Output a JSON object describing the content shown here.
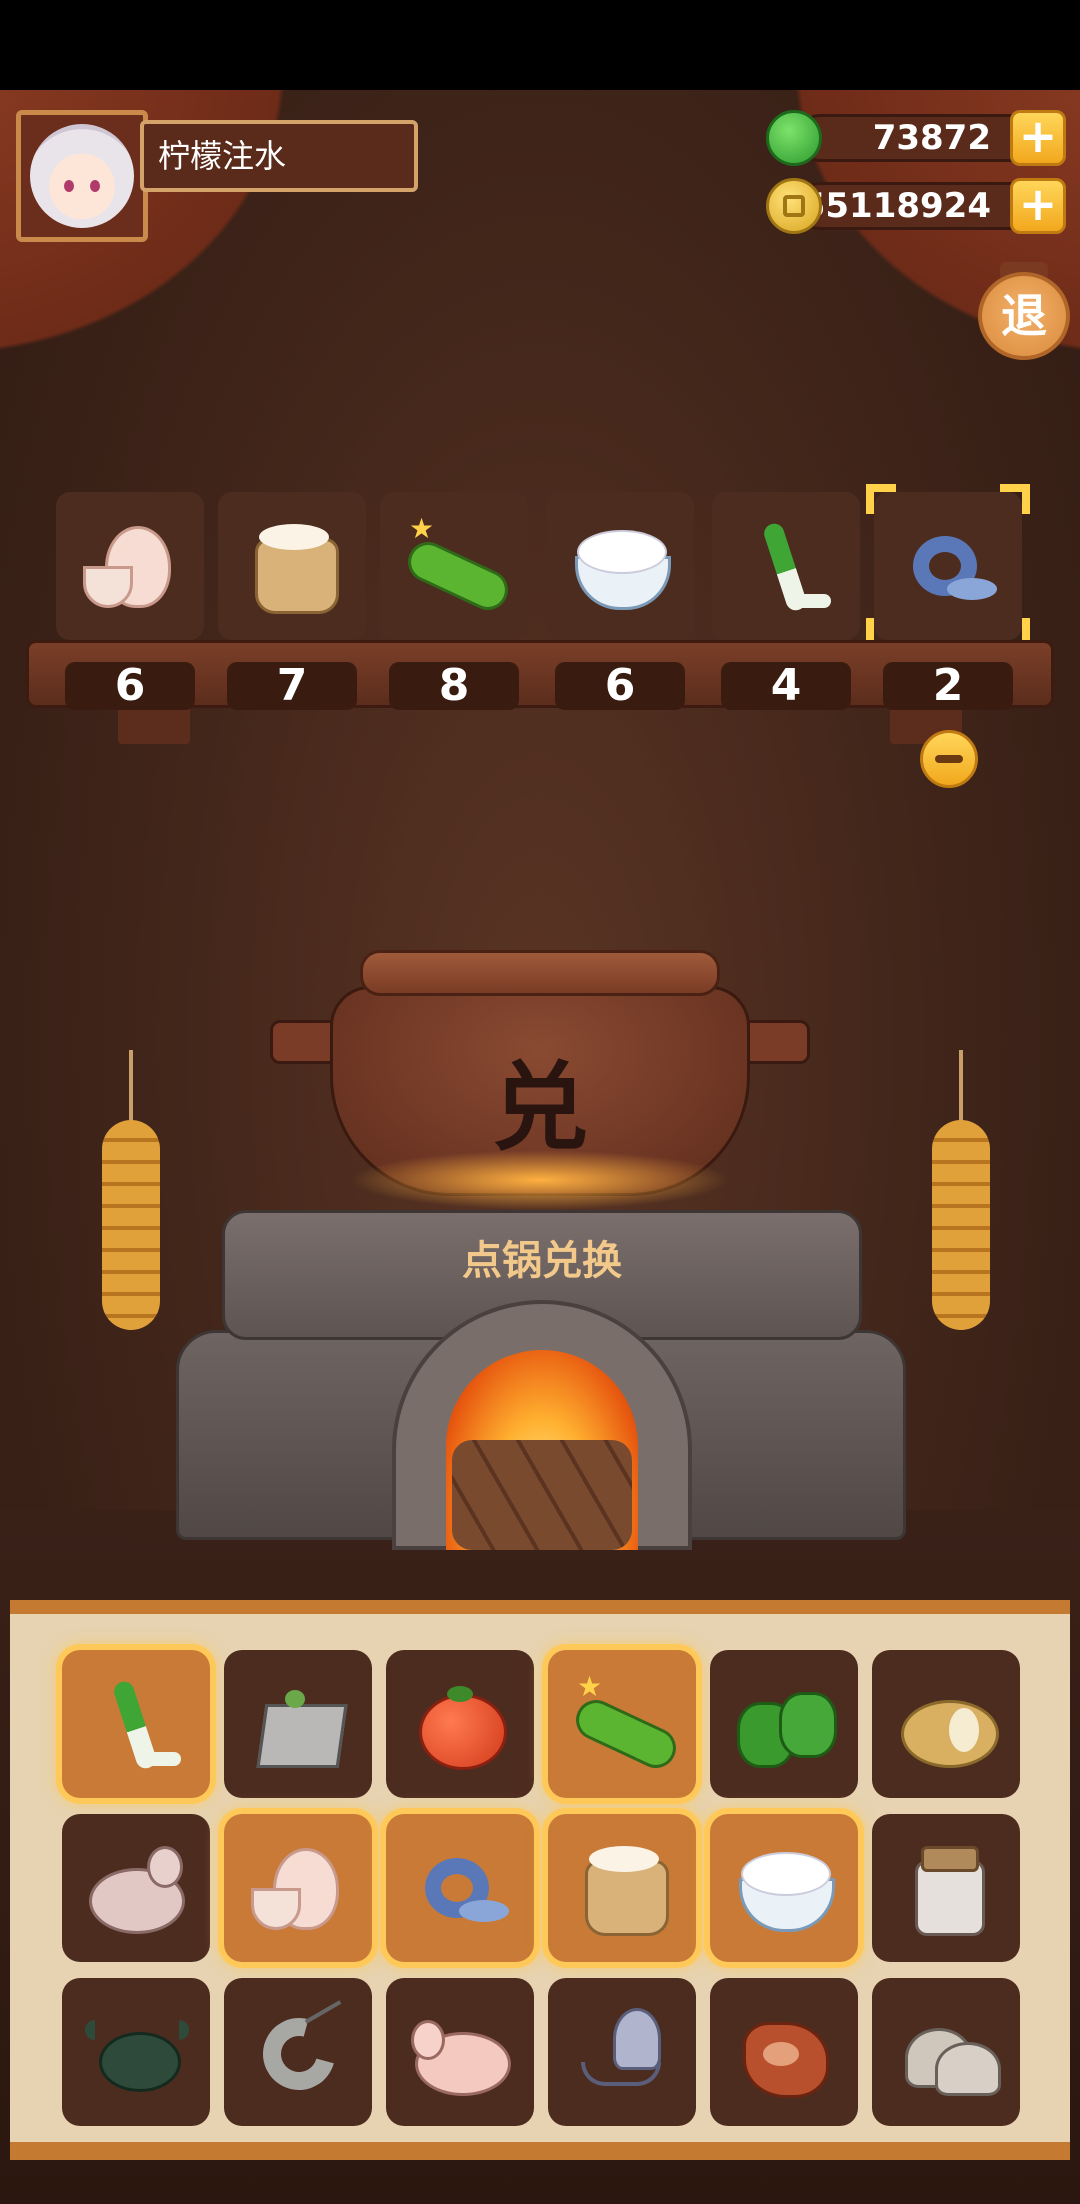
{
  "player": {
    "name": "柠檬注水",
    "avatar": "chef-girl-avatar"
  },
  "currencies": [
    {
      "icon": "jade-coin-icon",
      "value": "73872"
    },
    {
      "icon": "gold-coin-icon",
      "value": "55118924"
    }
  ],
  "exit_label": "退",
  "slots": [
    {
      "icon": "egg",
      "count": "6"
    },
    {
      "icon": "flour",
      "count": "7"
    },
    {
      "icon": "cucumber",
      "count": "8"
    },
    {
      "icon": "rice",
      "count": "6"
    },
    {
      "icon": "leek",
      "count": "4"
    },
    {
      "icon": "fish",
      "count": "2",
      "selected": true
    }
  ],
  "pot": {
    "glyph": "兑",
    "action_label": "点锅兑换"
  },
  "inventory": [
    [
      {
        "icon": "leek",
        "highlighted": true
      },
      {
        "icon": "tofu"
      },
      {
        "icon": "tomato"
      },
      {
        "icon": "cucumber",
        "highlighted": true
      },
      {
        "icon": "pepper"
      },
      {
        "icon": "potato"
      }
    ],
    [
      {
        "icon": "chicken"
      },
      {
        "icon": "egg",
        "highlighted": true
      },
      {
        "icon": "fish",
        "highlighted": true
      },
      {
        "icon": "flour",
        "highlighted": true
      },
      {
        "icon": "rice",
        "highlighted": true
      },
      {
        "icon": "jar"
      }
    ],
    [
      {
        "icon": "crab"
      },
      {
        "icon": "shrimp"
      },
      {
        "icon": "duck"
      },
      {
        "icon": "squid"
      },
      {
        "icon": "meat"
      },
      {
        "icon": "clam"
      }
    ]
  ]
}
